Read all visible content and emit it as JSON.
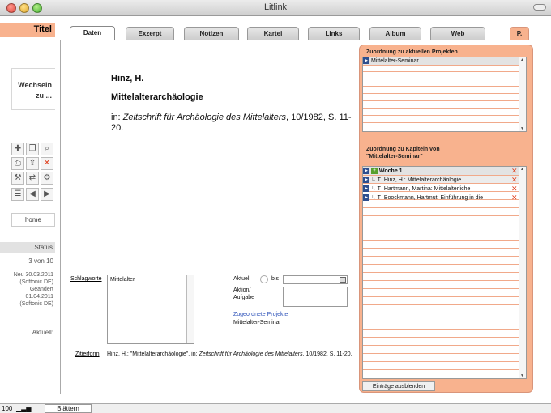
{
  "window": {
    "title": "Litlink"
  },
  "sidebar": {
    "titel": "Titel",
    "wechseln": "Wechseln zu ...",
    "home": "home",
    "status_label": "Status",
    "record_position": "3 von 10",
    "new_line1": "Neu 30.03.2011",
    "new_line2": "(Softonic DE)",
    "changed_line1": "Geändert",
    "changed_line2": "01.04.2011",
    "changed_line3": "(Softonic DE)",
    "aktuell": "Aktuell:"
  },
  "tabs": [
    {
      "label": "Daten"
    },
    {
      "label": "Exzerpt"
    },
    {
      "label": "Notizen"
    },
    {
      "label": "Kartei"
    },
    {
      "label": "Links"
    },
    {
      "label": "Album"
    },
    {
      "label": "Web"
    },
    {
      "label": "P."
    }
  ],
  "record": {
    "author": "Hinz, H.",
    "title": "Mittelalterarchäologie",
    "citation_prefix": "in: ",
    "journal": "Zeitschrift für Archäologie des Mittelalters",
    "citation_suffix": ", 10/1982, S. 11-20."
  },
  "form": {
    "schlagworte_label": "Schlagworte",
    "schlagworte_value": "Mittelalter",
    "aktuell_label": "Aktuell",
    "bis_label": "bis",
    "aktion_label1": "Aktion/",
    "aktion_label2": "Aufgabe",
    "zugeordnete_link": "Zugeordnete Projekte",
    "zugeordnete_value": "Mittelalter-Seminar",
    "zitierform_label": "Zitierform",
    "zitierform_prefix": "Hinz, H.: \"Mittelalterarchäologie\", in: ",
    "zitierform_journal": "Zeitschrift für Archäologie des Mittelalters",
    "zitierform_suffix": ", 10/1982, S. 11-20."
  },
  "right_panel": {
    "projects_title": "Zuordnung zu aktuellen Projekten",
    "projects": [
      "Mittelalter-Seminar"
    ],
    "chapters_title_line1": "Zuordnung zu Kapiteln von",
    "chapters_title_line2": "\"Mittelalter-Seminar\"",
    "chapter_group": "Woche 1",
    "chapters": [
      {
        "type": "T",
        "text": "Hinz, H.: Mittelalterarchäologie"
      },
      {
        "type": "T",
        "text": "Hartmann, Martina: Mittelalterliche"
      },
      {
        "type": "T",
        "text": "Boockmann, Hartmut: Einführung in die"
      }
    ],
    "hide_button": "Einträge ausblenden"
  },
  "statusbar": {
    "zoom": "100",
    "mode_button": "Blättern"
  },
  "colors": {
    "accent_peach": "#f8b28e",
    "icon_blue": "#2e4f8f",
    "delete_red": "#e0401e"
  }
}
